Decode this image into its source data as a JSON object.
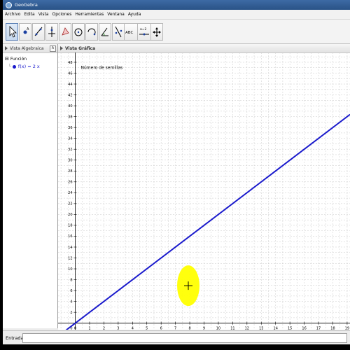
{
  "window": {
    "title": "GeoGebra"
  },
  "menu": [
    "Archivo",
    "Edita",
    "Vista",
    "Opciones",
    "Herramientas",
    "Ventana",
    "Ayuda"
  ],
  "toolbar": {
    "tools": [
      {
        "name": "move-tool",
        "active": true
      },
      {
        "name": "point-tool"
      },
      {
        "name": "line-tool"
      },
      {
        "name": "perpendicular-tool"
      },
      {
        "name": "polygon-tool"
      },
      {
        "name": "circle-tool"
      },
      {
        "name": "circle-arc-tool"
      },
      {
        "name": "angle-tool"
      },
      {
        "name": "reflect-tool"
      },
      {
        "name": "text-tool",
        "label": "ABC"
      },
      {
        "name": "slider-tool",
        "label": "a=2"
      },
      {
        "name": "move-view-tool"
      }
    ]
  },
  "algebra_view": {
    "title": "Vista Algebraica",
    "group_label": "Función",
    "items": [
      "f(x) = 2 x"
    ]
  },
  "graphics_view": {
    "title": "Vista Gráfica",
    "annotation": "Número de semillas"
  },
  "input_bar": {
    "label": "Entrada:",
    "value": ""
  },
  "colors": {
    "function_line": "#1a1acc",
    "highlight": "#ffff00",
    "titlebar": "#2f5b93"
  },
  "chart_data": {
    "type": "line",
    "series": [
      {
        "name": "f(x) = 2 x",
        "slope": 2,
        "intercept": 0
      }
    ],
    "x_ticks": [
      0,
      1,
      2,
      3,
      4,
      5,
      6,
      7,
      8,
      9,
      10,
      11,
      12,
      13,
      14,
      15,
      16,
      17,
      18,
      19
    ],
    "y_ticks": [
      0,
      2,
      4,
      6,
      8,
      10,
      12,
      14,
      16,
      18,
      20,
      22,
      24,
      26,
      28,
      30,
      32,
      34,
      36,
      38,
      40,
      42,
      44,
      46,
      48
    ],
    "xlim": [
      -1.2,
      19.2
    ],
    "ylim": [
      -1.2,
      49.8
    ],
    "grid": true,
    "cursor": {
      "x": 7.9,
      "y": 6.9
    }
  }
}
